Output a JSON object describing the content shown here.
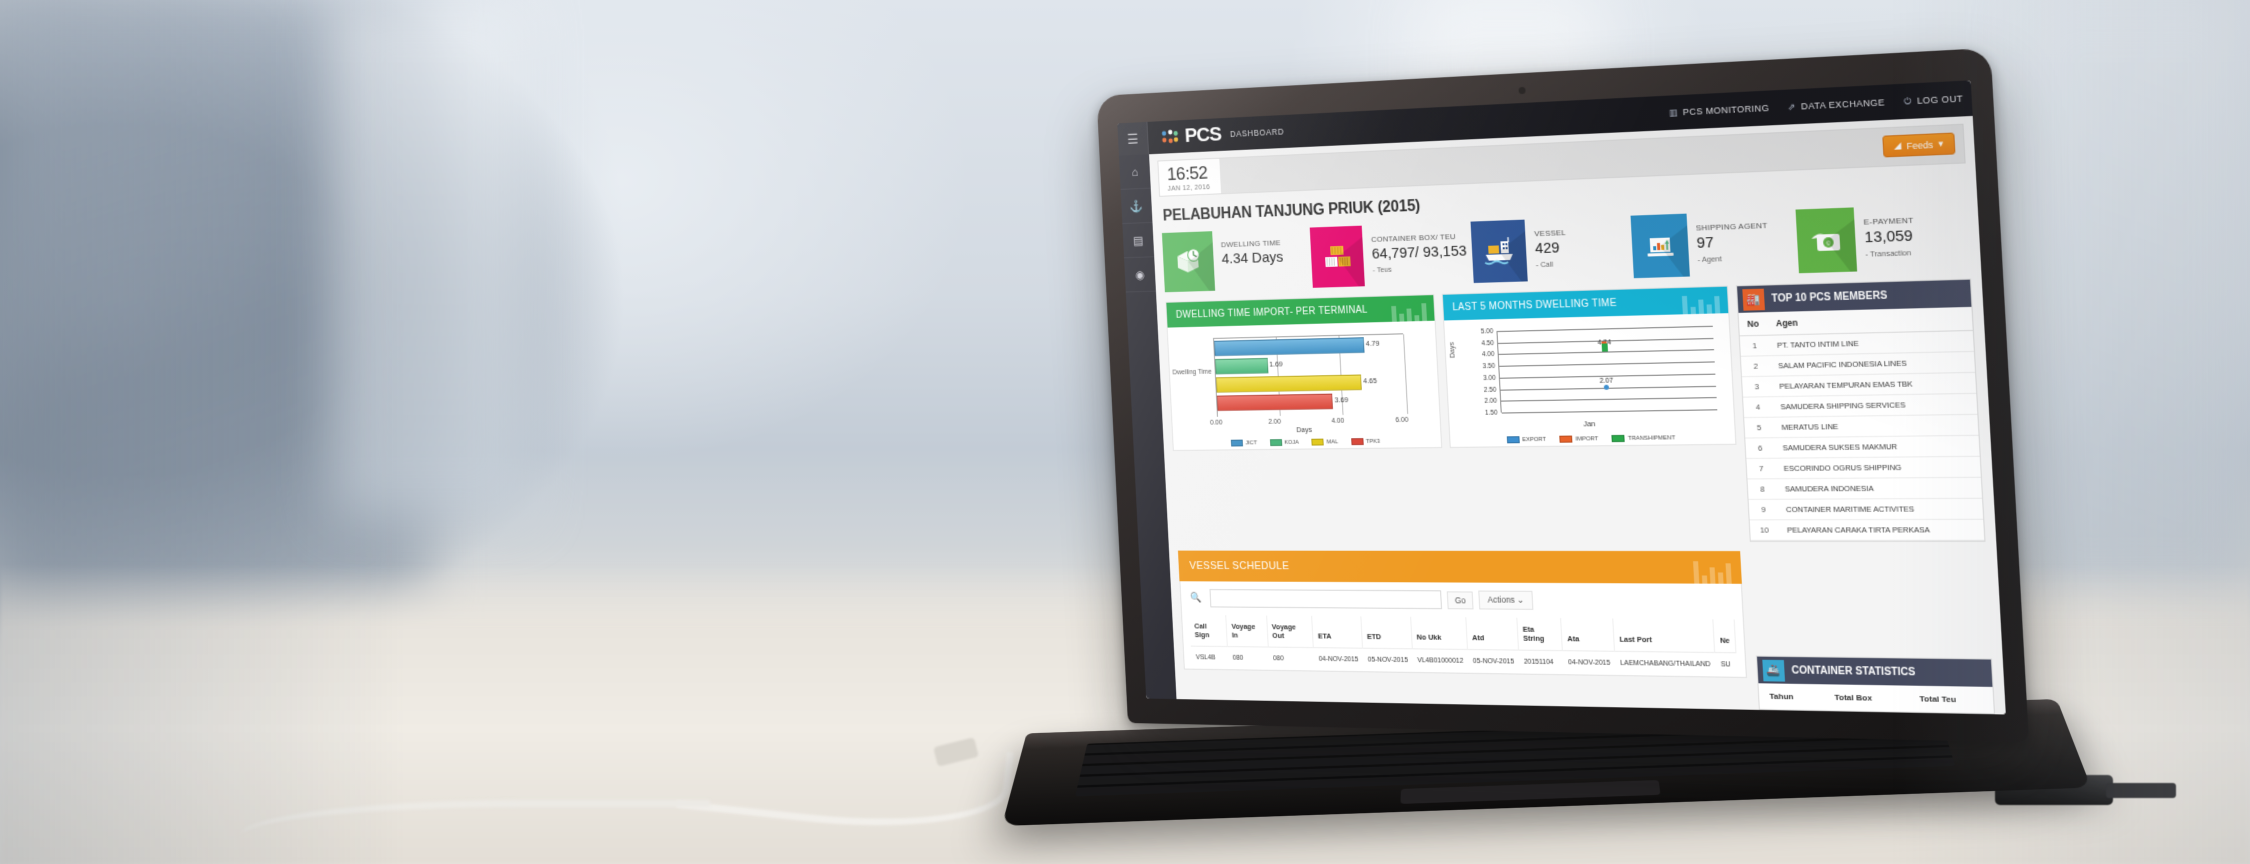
{
  "nav": {
    "hamburger_icon": "menu-icon",
    "brand": "PCS",
    "brand_sub": "DASHBOARD",
    "items": [
      {
        "label": "PCS MONITORING",
        "icon": "chart-bar-icon"
      },
      {
        "label": "DATA EXCHANGE",
        "icon": "exchange-icon"
      },
      {
        "label": "LOG OUT",
        "icon": "power-icon"
      }
    ]
  },
  "sidebar": {
    "items": [
      {
        "icon": "home-icon",
        "name": "home"
      },
      {
        "icon": "anchor-icon",
        "name": "anchor"
      },
      {
        "icon": "box-icon",
        "name": "container"
      },
      {
        "icon": "gear-icon",
        "name": "settings"
      }
    ]
  },
  "clock": {
    "time": "16:52",
    "date": "JAN 12, 2016"
  },
  "feeds": {
    "label": "Feeds",
    "caret": "▾",
    "icon": "feed-icon"
  },
  "page_title": "PELABUHAN TANJUNG PRIUK (2015)",
  "kpis": [
    {
      "label": "DWELLING TIME",
      "value": "4.34 Days",
      "unit": "",
      "color": "#5cb860",
      "icon": "box-clock-icon"
    },
    {
      "label": "CONTAINER BOX/ TEU",
      "value": "64,797/ 93,153",
      "unit": "- Teus",
      "color": "#e5096e",
      "icon": "container-stack-icon"
    },
    {
      "label": "VESSEL",
      "value": "429",
      "unit": "- Call",
      "color": "#2f5596",
      "icon": "ship-icon"
    },
    {
      "label": "SHIPPING AGENT",
      "value": "97",
      "unit": "- Agent",
      "color": "#2e8fc4",
      "icon": "laptop-chart-icon"
    },
    {
      "label": "E-PAYMENT",
      "value": "13,059",
      "unit": "- Transaction",
      "color": "#63b648",
      "icon": "payment-card-icon"
    }
  ],
  "panels": {
    "bar_panel_title": "DWELLING TIME IMPORT- PER TERMINAL",
    "bar_panel_color": "#2aa84a",
    "line_panel_title": "LAST 5 MONTHS DWELLING TIME",
    "line_panel_color": "#17b3d4",
    "members_title": "TOP 10 PCS MEMBERS",
    "members_icon": "factory-icon",
    "container_stats_title": "CONTAINER STATISTICS",
    "container_stats_icon": "ship-icon"
  },
  "chart_data": [
    {
      "type": "bar",
      "orientation": "horizontal",
      "title": "DWELLING TIME IMPORT- PER TERMINAL",
      "categories": [
        "JICT",
        "KOJA",
        "MAL",
        "TPK3"
      ],
      "values": [
        4.79,
        1.69,
        4.65,
        3.69
      ],
      "colors": [
        "#4f9fd4",
        "#5cc48c",
        "#e8d029",
        "#e2574c"
      ],
      "xlabel": "Days",
      "ylabel": "Dwelling Time",
      "xlim": [
        0,
        6
      ],
      "xticks": [
        "0.00",
        "2.00",
        "4.00",
        "6.00"
      ],
      "grid": true,
      "legend": [
        "JICT",
        "KOJA",
        "MAL",
        "TPK3"
      ],
      "legend_position": "bottom"
    },
    {
      "type": "line",
      "title": "LAST 5 MONTHS DWELLING TIME",
      "x": [
        "Jan"
      ],
      "series": [
        {
          "name": "EXPORT",
          "color": "#3d8fcf",
          "values": [
            2.07
          ]
        },
        {
          "name": "IMPORT",
          "color": "#e8622a",
          "values": [
            4.34
          ]
        },
        {
          "name": "TRANSHIPMENT",
          "color": "#2aa84a",
          "values": [
            4.21
          ]
        }
      ],
      "data_labels": [
        "4.34",
        "2.07"
      ],
      "xlabel": "Jan",
      "ylabel": "Days",
      "ylim": [
        1.5,
        5.0
      ],
      "yticks": [
        "5.00",
        "4.50",
        "4.00",
        "3.50",
        "3.00",
        "2.50",
        "2.00",
        "1.50"
      ],
      "grid": true,
      "legend": [
        "EXPORT",
        "IMPORT",
        "TRANSHIPMENT"
      ],
      "legend_position": "bottom"
    }
  ],
  "members": {
    "columns": [
      "No",
      "Agen"
    ],
    "rows": [
      [
        "1",
        "PT. TANTO INTIM LINE"
      ],
      [
        "2",
        "SALAM PACIFIC INDONESIA LINES"
      ],
      [
        "3",
        "PELAYARAN TEMPURAN EMAS TBK"
      ],
      [
        "4",
        "SAMUDERA SHIPPING SERVICES"
      ],
      [
        "5",
        "MERATUS LINE"
      ],
      [
        "6",
        "SAMUDERA SUKSES MAKMUR"
      ],
      [
        "7",
        "ESCORINDO OGRUS SHIPPING"
      ],
      [
        "8",
        "SAMUDERA INDONESIA"
      ],
      [
        "9",
        "CONTAINER MARITIME ACTIVITES"
      ],
      [
        "10",
        "PELAYARAN CARAKA TIRTA PERKASA"
      ]
    ]
  },
  "vessel": {
    "title": "VESSEL SCHEDULE",
    "search_placeholder": "",
    "search_value": "",
    "search_icon": "search-icon",
    "go_label": "Go",
    "actions_label": "Actions",
    "actions_caret": "⌄",
    "columns": [
      "Call Sign",
      "Voyage In",
      "Voyage Out",
      "ETA",
      "ETD",
      "No Ukk",
      "Atd",
      "Eta String",
      "Ata",
      "Last Port",
      "Ne"
    ],
    "rows": [
      [
        "VSL4B",
        "080",
        "080",
        "04-NOV-2015",
        "05-NOV-2015",
        "VL4B01000012",
        "05-NOV-2015",
        "20151104",
        "04-NOV-2015",
        "LAEMCHABANG/THAILAND",
        "SU"
      ]
    ]
  },
  "container_stats": {
    "columns": [
      "Tahun",
      "Total Box",
      "Total Teu"
    ]
  }
}
